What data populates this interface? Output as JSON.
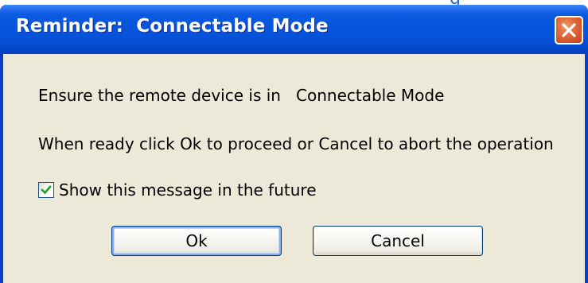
{
  "background": {
    "partial_text": "g"
  },
  "dialog": {
    "title": "Reminder:  Connectable Mode",
    "message_line1": "Ensure the remote device is in   Connectable Mode",
    "message_line2": "When ready click Ok to proceed or Cancel to abort the operation",
    "checkbox": {
      "label": "Show this message in the future",
      "checked": true
    },
    "buttons": {
      "ok_label": "Ok",
      "cancel_label": "Cancel"
    }
  },
  "colors": {
    "titlebar_blue": "#0754dc",
    "close_red": "#e06a3a",
    "client_bg": "#ece9d8",
    "check_green": "#21a121"
  },
  "icons": {
    "close": "close-x-icon",
    "check": "checkmark-icon"
  }
}
